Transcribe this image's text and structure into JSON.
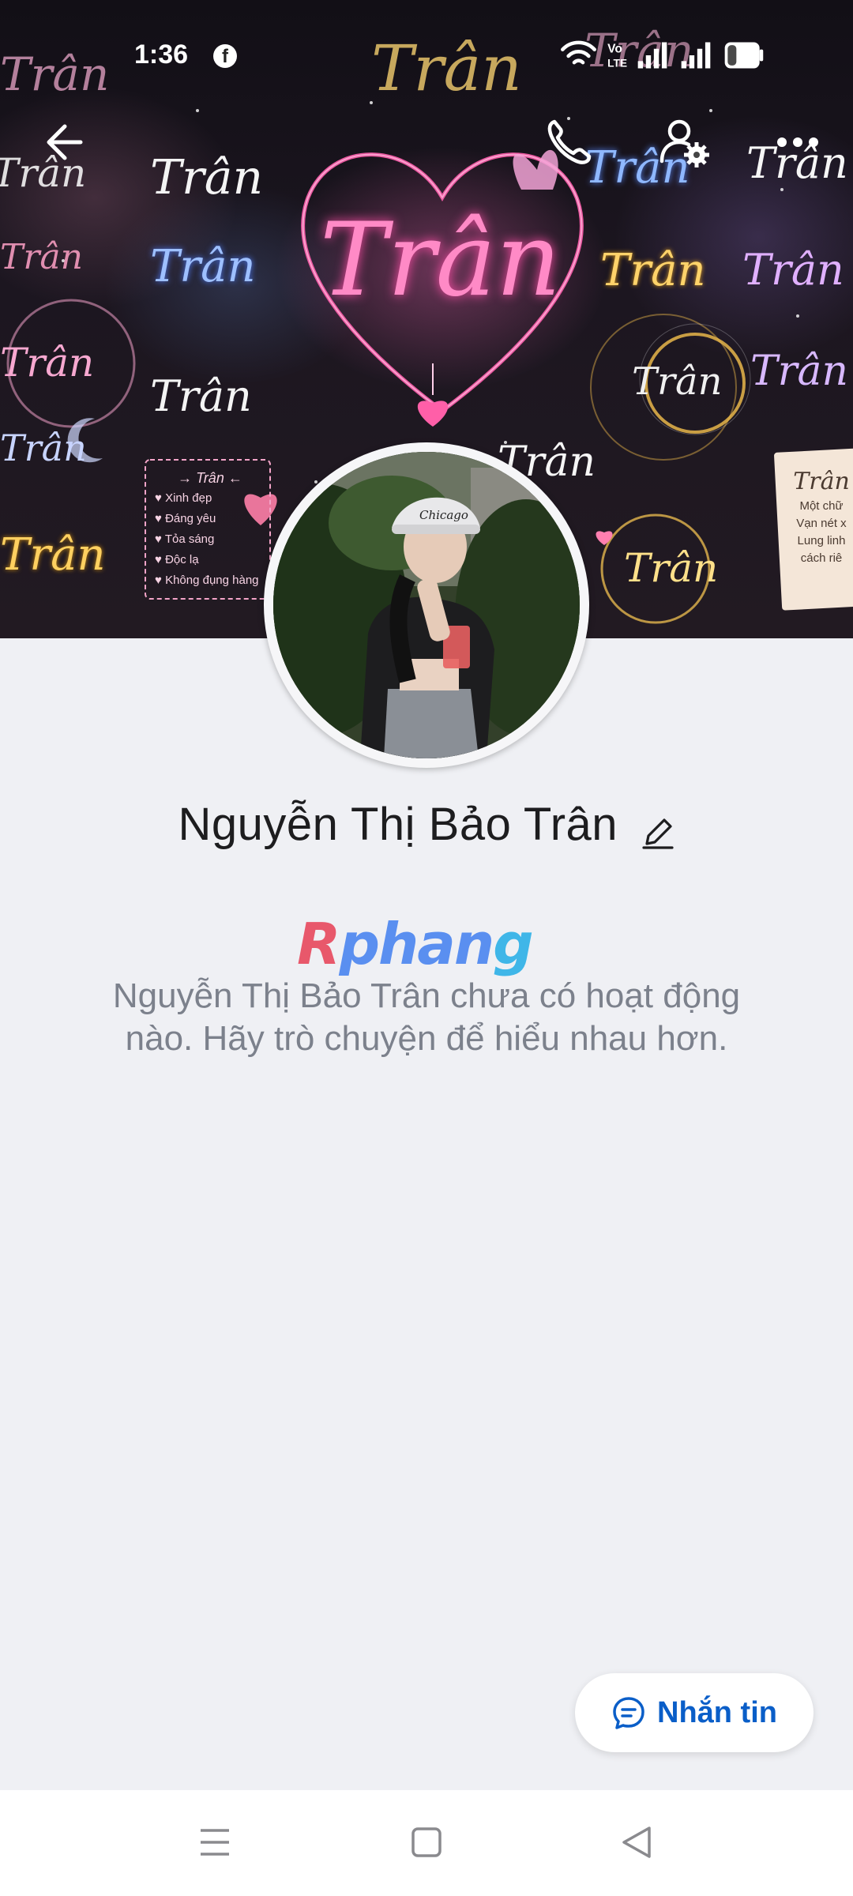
{
  "status_bar": {
    "time": "1:36",
    "notification_icon": "facebook-icon",
    "network_label": "Vo LTE",
    "battery_level": "4"
  },
  "cover": {
    "decorative_text": "Trân",
    "list_card": {
      "title": "→ Trân ←",
      "items": [
        "Xinh đẹp",
        "Đáng yêu",
        "Tỏa sáng",
        "Độc lạ",
        "Không đụng hàng"
      ]
    },
    "note_card": {
      "title": "Trân",
      "lines": [
        "Một chữ",
        "Vạn nét x",
        "Lung linh",
        "cách riê"
      ]
    }
  },
  "header": {
    "back_icon": "arrow-left-icon",
    "call_icon": "phone-icon",
    "friend_settings_icon": "person-gear-icon",
    "more_icon": "more-horizontal-icon"
  },
  "profile": {
    "name": "Nguyễn Thị Bảo Trân",
    "edit_icon": "pencil-icon",
    "avatar_cap_text": "Chicago"
  },
  "watermark": {
    "part_a": "R",
    "part_b": "phan",
    "part_c": "g"
  },
  "empty_state": {
    "message": "Nguyễn Thị Bảo Trân chưa có hoạt động nào. Hãy trò chuyện để hiểu nhau hơn."
  },
  "actions": {
    "message_button_label": "Nhắn tin",
    "message_icon": "chat-bubble-icon"
  },
  "system_nav": {
    "recent_icon": "menu-icon",
    "home_icon": "square-icon",
    "back_icon": "triangle-back-icon"
  },
  "colors": {
    "accent": "#0a5ec8",
    "background": "#eff0f4",
    "pink_glow": "#ff6ec7"
  }
}
